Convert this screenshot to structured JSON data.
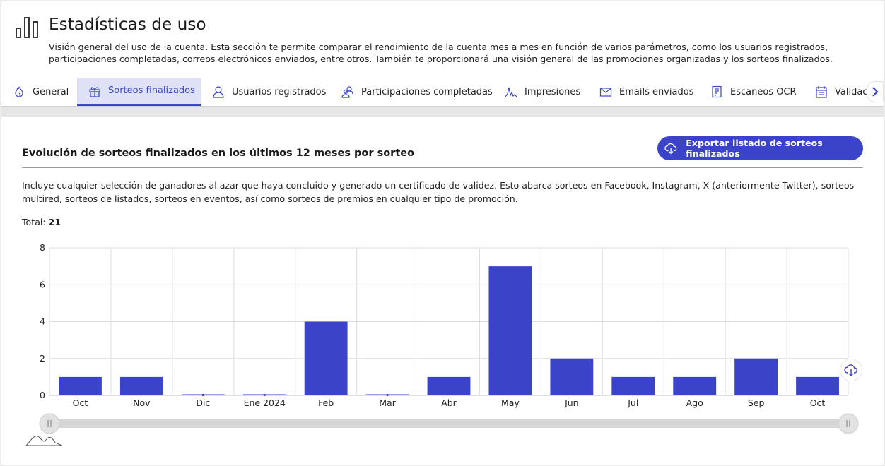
{
  "header": {
    "title": "Estadísticas de uso",
    "description": "Visión general del uso de la cuenta. Esta sección te permite comparar el rendimiento de la cuenta mes a mes en función de varios parámetros, como los usuarios registrados, participaciones completadas, correos electrónicos enviados, entre otros. También te proporcionará una visión general de las promociones organizadas y los sorteos finalizados.",
    "icon": "bar-chart-icon"
  },
  "tabs": [
    {
      "label": "General",
      "icon": "flame-icon",
      "active": false
    },
    {
      "label": "Sorteos finalizados",
      "icon": "gift-icon",
      "active": true
    },
    {
      "label": "Usuarios registrados",
      "icon": "user-icon",
      "active": false
    },
    {
      "label": "Participaciones completadas",
      "icon": "users-icon",
      "active": false
    },
    {
      "label": "Impresiones",
      "icon": "wave-icon",
      "active": false
    },
    {
      "label": "Emails enviados",
      "icon": "envelope-icon",
      "active": false
    },
    {
      "label": "Escaneos OCR",
      "icon": "document-scan-icon",
      "active": false
    },
    {
      "label": "Validaciones",
      "icon": "calendar-list-icon",
      "active": false
    }
  ],
  "section": {
    "title": "Evolución de sorteos finalizados en los últimos 12 meses por sorteo",
    "export_label": "Exportar listado de sorteos finalizados",
    "description": "Incluye cualquier selección de ganadores al azar que haya concluido y generado un certificado de validez. Esto abarca sorteos en Facebook, Instagram, X (anteriormente Twitter), sorteos multired, sorteos de listados, sorteos en eventos, así como sorteos de premios en cualquier tipo de promoción.",
    "total_label": "Total:",
    "total_value": "21"
  },
  "colors": {
    "accent": "#3b44c8",
    "tab_active_bg": "#dfe2f6",
    "grid": "#dddddd",
    "slider_track": "#d6d6d6"
  },
  "chart_data": {
    "type": "bar",
    "categories": [
      "Oct",
      "Nov",
      "Dic",
      "Ene 2024",
      "Feb",
      "Mar",
      "Abr",
      "May",
      "Jun",
      "Jul",
      "Ago",
      "Sep",
      "Oct"
    ],
    "values": [
      1,
      1,
      0,
      0,
      4,
      0,
      1,
      7,
      2,
      1,
      1,
      2,
      1
    ],
    "ylim": [
      0,
      8
    ],
    "yticks": [
      0,
      2,
      4,
      6,
      8
    ],
    "grid": true,
    "legend": "none",
    "color": "#3b44c8",
    "navigator": true
  }
}
